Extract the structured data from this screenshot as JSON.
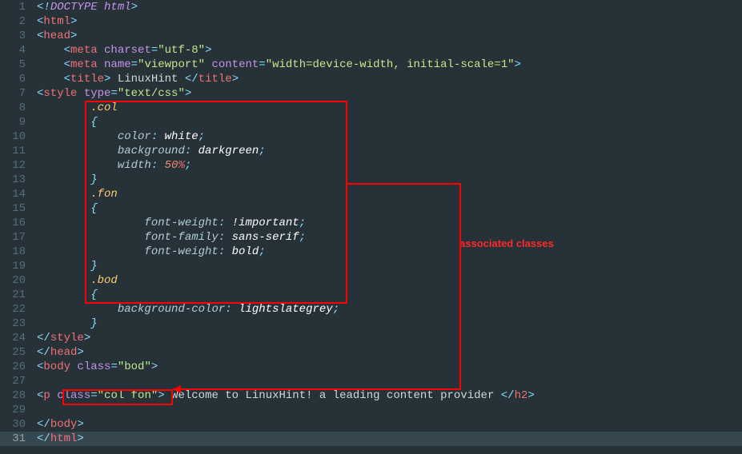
{
  "annotation_label": "associated classes",
  "lines": {
    "l1": {
      "n": "1"
    },
    "l2": {
      "n": "2"
    },
    "l3": {
      "n": "3"
    },
    "l4": {
      "n": "4",
      "charset_attr": "charset",
      "charset_val": "\"utf-8\""
    },
    "l5": {
      "n": "5",
      "name_attr": "name",
      "name_val": "\"viewport\"",
      "content_attr": "content",
      "content_val": "\"width=device-width, initial-scale=1\""
    },
    "l6": {
      "n": "6",
      "title_text": " LinuxHint "
    },
    "l7": {
      "n": "7",
      "type_attr": "type",
      "type_val": "\"text/css\""
    },
    "l8": {
      "n": "8",
      "sel": ".col"
    },
    "l9": {
      "n": "9",
      "brace": "{"
    },
    "l10": {
      "n": "10",
      "prop": "color",
      "val": "white"
    },
    "l11": {
      "n": "11",
      "prop": "background",
      "val": "darkgreen"
    },
    "l12": {
      "n": "12",
      "prop": "width",
      "num": "50",
      "unit": "%"
    },
    "l13": {
      "n": "13",
      "brace": "}"
    },
    "l14": {
      "n": "14",
      "sel": ".fon"
    },
    "l15": {
      "n": "15",
      "brace": "{"
    },
    "l16": {
      "n": "16",
      "prop": "font-weight",
      "val": "!important"
    },
    "l17": {
      "n": "17",
      "prop": "font-family",
      "val": "sans-serif"
    },
    "l18": {
      "n": "18",
      "prop": "font-weight",
      "val": "bold"
    },
    "l19": {
      "n": "19",
      "brace": "}"
    },
    "l20": {
      "n": "20",
      "sel": ".bod"
    },
    "l21": {
      "n": "21",
      "brace": "{"
    },
    "l22": {
      "n": "22",
      "prop": "background-color",
      "val": "lightslategrey"
    },
    "l23": {
      "n": "23",
      "brace": "}"
    },
    "l24": {
      "n": "24"
    },
    "l25": {
      "n": "25"
    },
    "l26": {
      "n": "26",
      "class_attr": "class",
      "class_val": "\"bod\""
    },
    "l27": {
      "n": "27"
    },
    "l28": {
      "n": "28",
      "class_attr": "class",
      "class_val": "\"col fon\"",
      "text": " Welcome to LinuxHint! a leading content provider "
    },
    "l29": {
      "n": "29"
    },
    "l30": {
      "n": "30"
    },
    "l31": {
      "n": "31"
    }
  },
  "tags": {
    "doctype_open": "<!",
    "doctype_word": "DOCTYPE",
    "doctype_html": "html",
    "doctype_close": ">",
    "html": "html",
    "head": "head",
    "meta": "meta",
    "title": "title",
    "style": "style",
    "body": "body",
    "p": "p",
    "h2": "h2"
  }
}
